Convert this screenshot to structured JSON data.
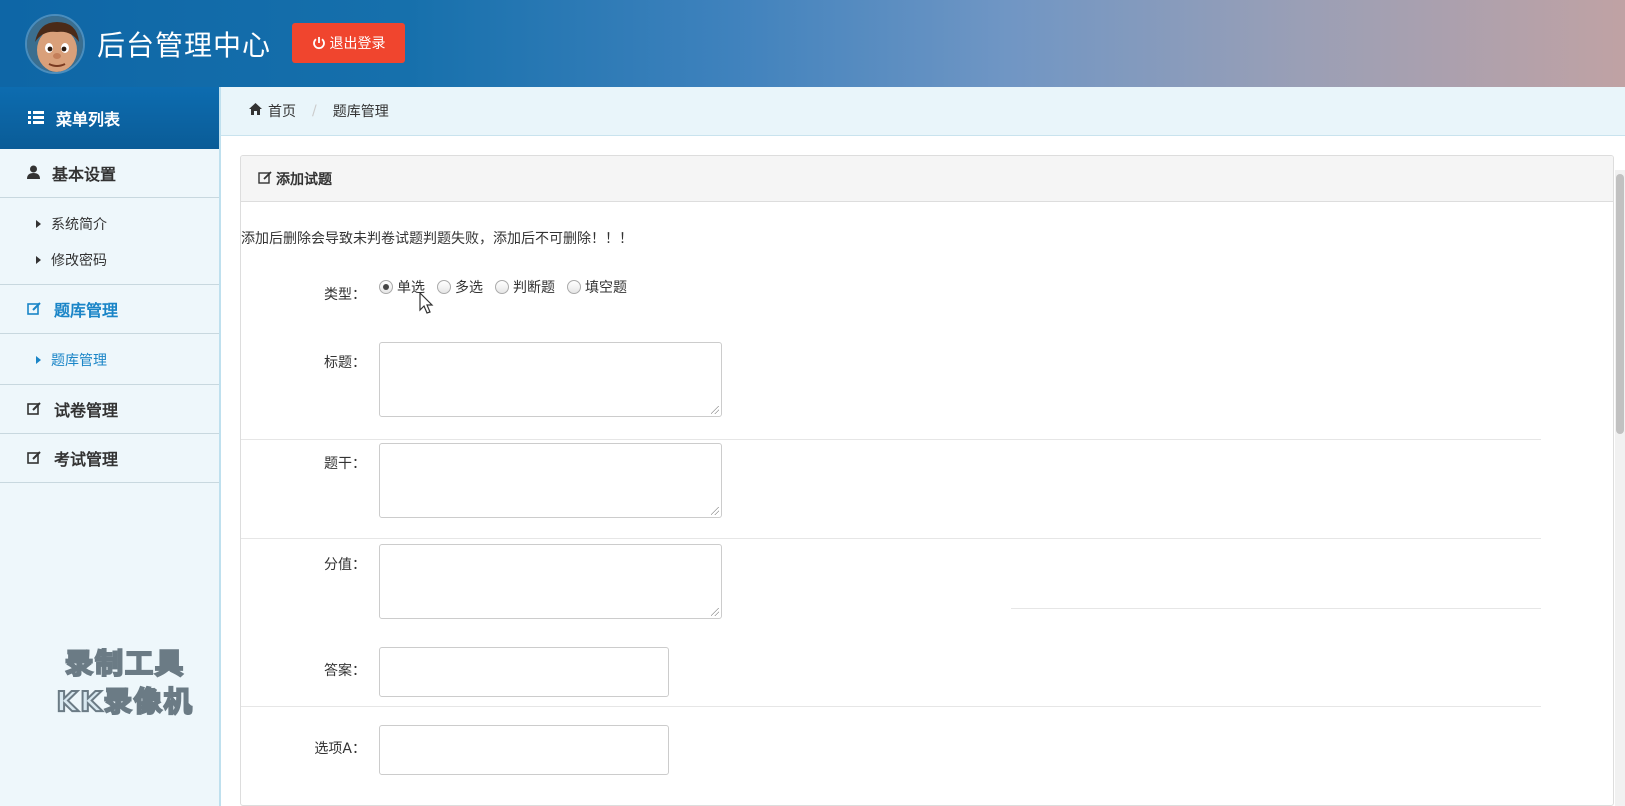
{
  "header": {
    "title": "后台管理中心",
    "logout_label": "退出登录"
  },
  "sidebar": {
    "menu_title": "菜单列表",
    "sections": [
      {
        "label": "基本设置",
        "items": [
          "系统简介",
          "修改密码"
        ]
      },
      {
        "label": "题库管理",
        "items": [
          "题库管理"
        ]
      },
      {
        "label": "试卷管理"
      },
      {
        "label": "考试管理"
      }
    ],
    "watermark": [
      "录制工具",
      "KK录像机"
    ]
  },
  "breadcrumb": {
    "home": "首页",
    "current": "题库管理"
  },
  "panel": {
    "title": "添加试题",
    "notice": "添加后删除会导致未判卷试题判题失败，添加后不可删除！！！",
    "fields": {
      "type_label": "类型：",
      "type_options": [
        "单选",
        "多选",
        "判断题",
        "填空题"
      ],
      "type_selected": "单选",
      "title_label": "标题：",
      "stem_label": "题干：",
      "score_label": "分值：",
      "answer_label": "答案：",
      "option_a_label": "选项A："
    }
  },
  "colors": {
    "accent": "#1a85c7",
    "logout": "#f0452e",
    "menu_header": "#0d6cb0"
  }
}
